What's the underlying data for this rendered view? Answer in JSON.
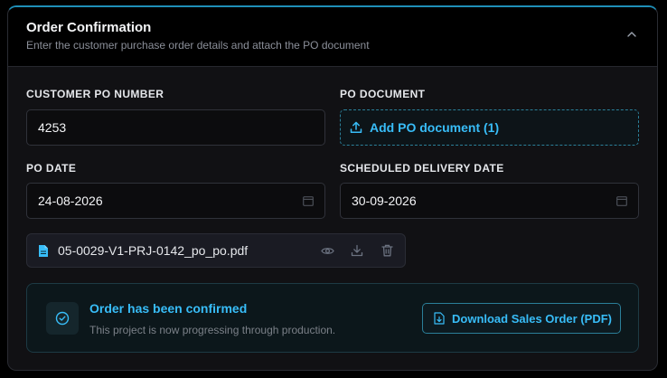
{
  "header": {
    "title": "Order Confirmation",
    "subtitle": "Enter the customer purchase order details and attach the PO document",
    "collapse_icon": "chevron-up-icon"
  },
  "form": {
    "customer_po_label": "CUSTOMER PO NUMBER",
    "customer_po_value": "4253",
    "po_document_label": "PO DOCUMENT",
    "po_document_button": "Add PO document (1)",
    "po_date_label": "PO DATE",
    "po_date_value": "24-08-2026",
    "delivery_date_label": "SCHEDULED DELIVERY DATE",
    "delivery_date_value": "30-09-2026"
  },
  "attachment": {
    "file_name": "05-0029-V1-PRJ-0142_po_po.pdf",
    "icons": [
      "file-icon",
      "eye-icon",
      "download-icon",
      "trash-icon"
    ]
  },
  "confirmation": {
    "title": "Order has been confirmed",
    "subtitle": "This project is now progressing through production.",
    "download_button": "Download Sales Order (PDF)"
  },
  "colors": {
    "accent": "#38bdf8",
    "background": "#000000",
    "card": "#111114",
    "border": "#30323a"
  }
}
